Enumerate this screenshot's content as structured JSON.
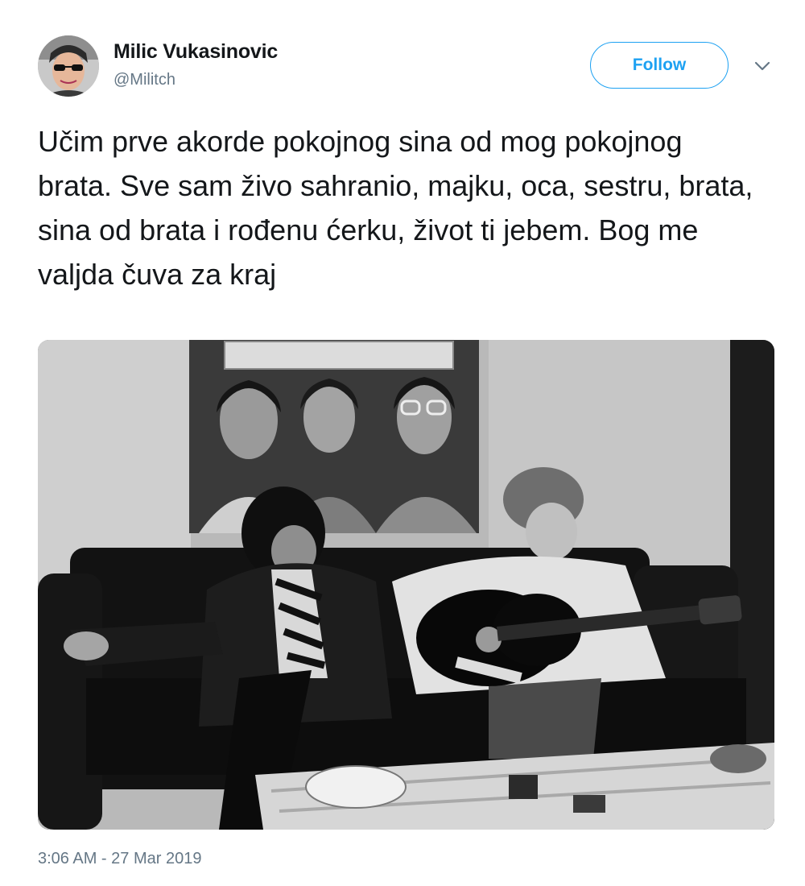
{
  "author": {
    "display_name": "Milic Vukasinovic",
    "handle": "@Militch"
  },
  "actions": {
    "follow_label": "Follow",
    "more_icon": "chevron-down-icon"
  },
  "tweet": {
    "text": "Učim prve akorde pokojnog sina od mog pokojnog brata. Sve sam živo sahranio, majku, oca, sestru, brata, sina od brata i rođenu ćerku, život ti jebem. Bog me valjda čuva za kraj",
    "timestamp": "3:06 AM - 27 Mar 2019"
  },
  "colors": {
    "accent": "#1da1f2",
    "text_primary": "#14171a",
    "text_secondary": "#657786"
  }
}
